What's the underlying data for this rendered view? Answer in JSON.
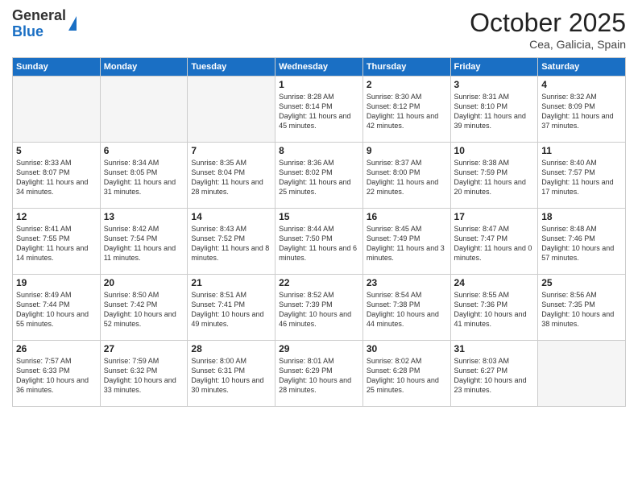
{
  "logo": {
    "general": "General",
    "blue": "Blue"
  },
  "header": {
    "month": "October 2025",
    "location": "Cea, Galicia, Spain"
  },
  "weekdays": [
    "Sunday",
    "Monday",
    "Tuesday",
    "Wednesday",
    "Thursday",
    "Friday",
    "Saturday"
  ],
  "weeks": [
    [
      {
        "day": "",
        "info": ""
      },
      {
        "day": "",
        "info": ""
      },
      {
        "day": "",
        "info": ""
      },
      {
        "day": "1",
        "info": "Sunrise: 8:28 AM\nSunset: 8:14 PM\nDaylight: 11 hours and 45 minutes."
      },
      {
        "day": "2",
        "info": "Sunrise: 8:30 AM\nSunset: 8:12 PM\nDaylight: 11 hours and 42 minutes."
      },
      {
        "day": "3",
        "info": "Sunrise: 8:31 AM\nSunset: 8:10 PM\nDaylight: 11 hours and 39 minutes."
      },
      {
        "day": "4",
        "info": "Sunrise: 8:32 AM\nSunset: 8:09 PM\nDaylight: 11 hours and 37 minutes."
      }
    ],
    [
      {
        "day": "5",
        "info": "Sunrise: 8:33 AM\nSunset: 8:07 PM\nDaylight: 11 hours and 34 minutes."
      },
      {
        "day": "6",
        "info": "Sunrise: 8:34 AM\nSunset: 8:05 PM\nDaylight: 11 hours and 31 minutes."
      },
      {
        "day": "7",
        "info": "Sunrise: 8:35 AM\nSunset: 8:04 PM\nDaylight: 11 hours and 28 minutes."
      },
      {
        "day": "8",
        "info": "Sunrise: 8:36 AM\nSunset: 8:02 PM\nDaylight: 11 hours and 25 minutes."
      },
      {
        "day": "9",
        "info": "Sunrise: 8:37 AM\nSunset: 8:00 PM\nDaylight: 11 hours and 22 minutes."
      },
      {
        "day": "10",
        "info": "Sunrise: 8:38 AM\nSunset: 7:59 PM\nDaylight: 11 hours and 20 minutes."
      },
      {
        "day": "11",
        "info": "Sunrise: 8:40 AM\nSunset: 7:57 PM\nDaylight: 11 hours and 17 minutes."
      }
    ],
    [
      {
        "day": "12",
        "info": "Sunrise: 8:41 AM\nSunset: 7:55 PM\nDaylight: 11 hours and 14 minutes."
      },
      {
        "day": "13",
        "info": "Sunrise: 8:42 AM\nSunset: 7:54 PM\nDaylight: 11 hours and 11 minutes."
      },
      {
        "day": "14",
        "info": "Sunrise: 8:43 AM\nSunset: 7:52 PM\nDaylight: 11 hours and 8 minutes."
      },
      {
        "day": "15",
        "info": "Sunrise: 8:44 AM\nSunset: 7:50 PM\nDaylight: 11 hours and 6 minutes."
      },
      {
        "day": "16",
        "info": "Sunrise: 8:45 AM\nSunset: 7:49 PM\nDaylight: 11 hours and 3 minutes."
      },
      {
        "day": "17",
        "info": "Sunrise: 8:47 AM\nSunset: 7:47 PM\nDaylight: 11 hours and 0 minutes."
      },
      {
        "day": "18",
        "info": "Sunrise: 8:48 AM\nSunset: 7:46 PM\nDaylight: 10 hours and 57 minutes."
      }
    ],
    [
      {
        "day": "19",
        "info": "Sunrise: 8:49 AM\nSunset: 7:44 PM\nDaylight: 10 hours and 55 minutes."
      },
      {
        "day": "20",
        "info": "Sunrise: 8:50 AM\nSunset: 7:42 PM\nDaylight: 10 hours and 52 minutes."
      },
      {
        "day": "21",
        "info": "Sunrise: 8:51 AM\nSunset: 7:41 PM\nDaylight: 10 hours and 49 minutes."
      },
      {
        "day": "22",
        "info": "Sunrise: 8:52 AM\nSunset: 7:39 PM\nDaylight: 10 hours and 46 minutes."
      },
      {
        "day": "23",
        "info": "Sunrise: 8:54 AM\nSunset: 7:38 PM\nDaylight: 10 hours and 44 minutes."
      },
      {
        "day": "24",
        "info": "Sunrise: 8:55 AM\nSunset: 7:36 PM\nDaylight: 10 hours and 41 minutes."
      },
      {
        "day": "25",
        "info": "Sunrise: 8:56 AM\nSunset: 7:35 PM\nDaylight: 10 hours and 38 minutes."
      }
    ],
    [
      {
        "day": "26",
        "info": "Sunrise: 7:57 AM\nSunset: 6:33 PM\nDaylight: 10 hours and 36 minutes."
      },
      {
        "day": "27",
        "info": "Sunrise: 7:59 AM\nSunset: 6:32 PM\nDaylight: 10 hours and 33 minutes."
      },
      {
        "day": "28",
        "info": "Sunrise: 8:00 AM\nSunset: 6:31 PM\nDaylight: 10 hours and 30 minutes."
      },
      {
        "day": "29",
        "info": "Sunrise: 8:01 AM\nSunset: 6:29 PM\nDaylight: 10 hours and 28 minutes."
      },
      {
        "day": "30",
        "info": "Sunrise: 8:02 AM\nSunset: 6:28 PM\nDaylight: 10 hours and 25 minutes."
      },
      {
        "day": "31",
        "info": "Sunrise: 8:03 AM\nSunset: 6:27 PM\nDaylight: 10 hours and 23 minutes."
      },
      {
        "day": "",
        "info": ""
      }
    ]
  ]
}
